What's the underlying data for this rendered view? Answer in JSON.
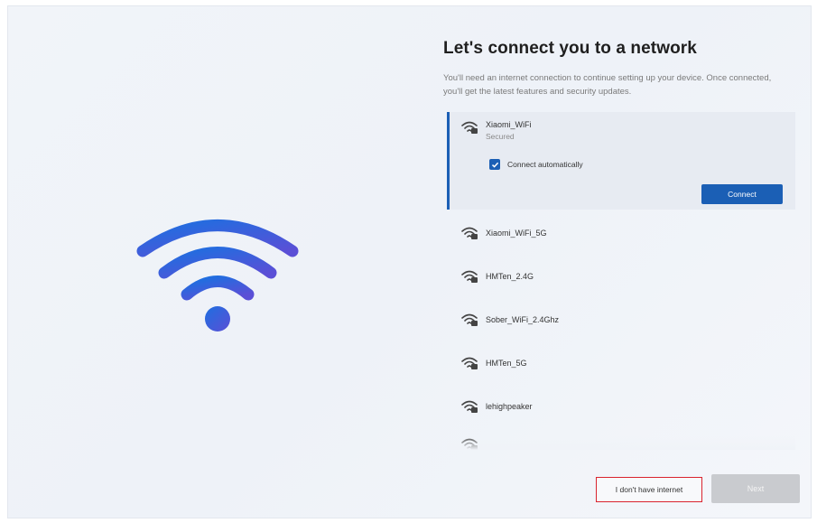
{
  "page": {
    "title": "Let's connect you to a network",
    "description": "You'll need an internet connection to continue setting up your device. Once connected, you'll get the latest features and security updates."
  },
  "networks": [
    {
      "name": "Xiaomi_WiFi",
      "status": "Secured",
      "icon": "wifi-secured-icon"
    },
    {
      "name": "Xiaomi_WiFi_5G",
      "icon": "wifi-secured-icon"
    },
    {
      "name": "HMTen_2.4G",
      "icon": "wifi-secured-icon"
    },
    {
      "name": "Sober_WiFi_2.4Ghz",
      "icon": "wifi-secured-icon"
    },
    {
      "name": "HMTen_5G",
      "icon": "wifi-secured-icon"
    },
    {
      "name": "lehighpeaker",
      "icon": "wifi-secured-icon"
    }
  ],
  "selected": {
    "connect_auto_label": "Connect automatically",
    "connect_auto_checked": true,
    "connect_button": "Connect"
  },
  "footer": {
    "no_internet_label": "I don't have internet",
    "next_label": "Next"
  },
  "colors": {
    "accent": "#1b5fb5",
    "highlight_border": "#d9232e",
    "hero_wifi_from": "#1e6fe0",
    "hero_wifi_to": "#5b4fd6"
  }
}
